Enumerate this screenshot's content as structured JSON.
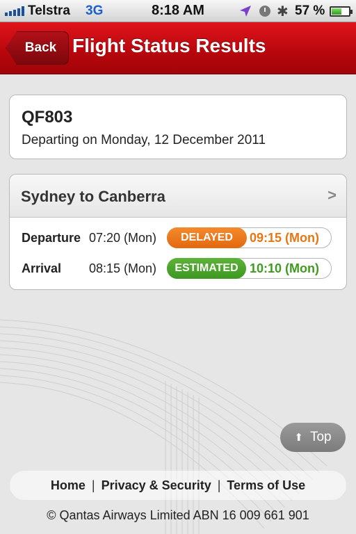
{
  "status_bar": {
    "carrier": "Telstra",
    "network": "3G",
    "time": "8:18 AM",
    "battery": "57 %",
    "battery_level": 0.57,
    "icons": [
      "signal-icon",
      "location-icon",
      "clock-icon",
      "bluetooth-icon",
      "battery-icon"
    ]
  },
  "nav": {
    "back_label": "Back",
    "title": "Flight Status Results"
  },
  "flight": {
    "number": "QF803",
    "departing": "Departing on Monday, 12 December 2011"
  },
  "route": {
    "title": "Sydney to Canberra",
    "departure": {
      "label": "Departure",
      "scheduled": "07:20 (Mon)",
      "status": "DELAYED",
      "new_time": "09:15 (Mon)",
      "status_color": "#e87612"
    },
    "arrival": {
      "label": "Arrival",
      "scheduled": "08:15 (Mon)",
      "status": "ESTIMATED",
      "new_time": "10:10 (Mon)",
      "status_color": "#3f9a20"
    }
  },
  "top_button": {
    "label": "Top"
  },
  "footer": {
    "links": [
      "Home",
      "Privacy & Security",
      "Terms of Use"
    ],
    "separator": "|",
    "copyright": "© Qantas Airways Limited ABN 16 009 661 901"
  },
  "colors": {
    "brand_red": "#c40a12",
    "delayed": "#e87612",
    "estimated": "#3f9a20"
  }
}
